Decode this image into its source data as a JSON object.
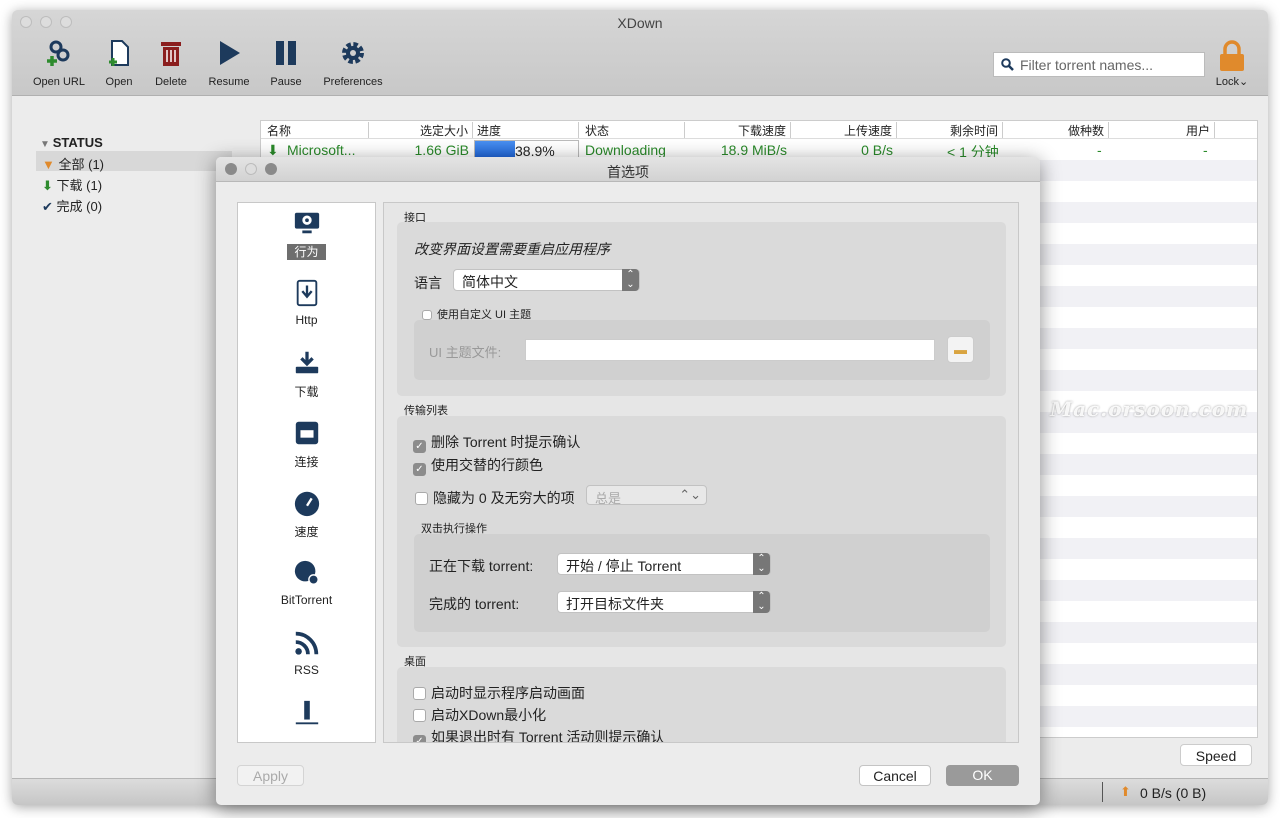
{
  "window": {
    "title": "XDown"
  },
  "toolbar": {
    "items": [
      {
        "label": "Open URL",
        "icon": "link-add-icon"
      },
      {
        "label": "Open",
        "icon": "file-add-icon"
      },
      {
        "label": "Delete",
        "icon": "trash-icon"
      },
      {
        "label": "Resume",
        "icon": "play-icon"
      },
      {
        "label": "Pause",
        "icon": "pause-icon"
      },
      {
        "label": "Preferences",
        "icon": "gear-icon"
      }
    ],
    "filter_placeholder": "Filter torrent names...",
    "lock_label": "Lock"
  },
  "sidebar": {
    "header": "STATUS",
    "items": [
      {
        "label": "全部 (1)",
        "icon": "filter-icon"
      },
      {
        "label": "下载 (1)",
        "icon": "download-arrow-icon"
      },
      {
        "label": "完成 (0)",
        "icon": "check-icon"
      }
    ]
  },
  "table": {
    "columns": [
      "名称",
      "选定大小",
      "进度",
      "状态",
      "下载速度",
      "上传速度",
      "剩余时间",
      "做种数",
      "用户"
    ],
    "rows": [
      {
        "name": "Microsoft...",
        "size": "1.66 GiB",
        "progress": "38.9%",
        "progress_value": 38.9,
        "status": "Downloading",
        "down": "18.9 MiB/s",
        "up": "0 B/s",
        "eta": "< 1 分钟",
        "seeds": "-",
        "peers": "-"
      }
    ]
  },
  "speed_button": "Speed",
  "statusbar": {
    "upload": "0 B/s (0 B)"
  },
  "watermark": "Mac.orsoon.com",
  "dialog": {
    "title": "首选项",
    "nav": [
      {
        "label": "行为"
      },
      {
        "label": "Http"
      },
      {
        "label": "下载"
      },
      {
        "label": "连接"
      },
      {
        "label": "速度"
      },
      {
        "label": "BitTorrent"
      },
      {
        "label": "RSS"
      }
    ],
    "interface": {
      "title": "接口",
      "note": "改变界面设置需要重启应用程序",
      "language_label": "语言",
      "language_value": "简体中文",
      "custom_theme_label": "使用自定义 UI 主题",
      "theme_file_label": "UI 主题文件:",
      "theme_file_value": ""
    },
    "transfer": {
      "title": "传输列表",
      "confirm_delete": "删除 Torrent 时提示确认",
      "alt_rows": "使用交替的行颜色",
      "hide_zero": "隐藏为 0 及无穷大的项",
      "hide_zero_value": "总是",
      "dblclick_title": "双击执行操作",
      "downloading_label": "正在下载 torrent:",
      "downloading_value": "开始 / 停止 Torrent",
      "completed_label": "完成的 torrent:",
      "completed_value": "打开目标文件夹"
    },
    "desktop": {
      "title": "桌面",
      "splash": "启动时显示程序启动画面",
      "minimized": "启动XDown最小化",
      "confirm_exit": "如果退出时有 Torrent 活动则提示确认"
    },
    "apply": "Apply",
    "cancel": "Cancel",
    "ok": "OK"
  }
}
